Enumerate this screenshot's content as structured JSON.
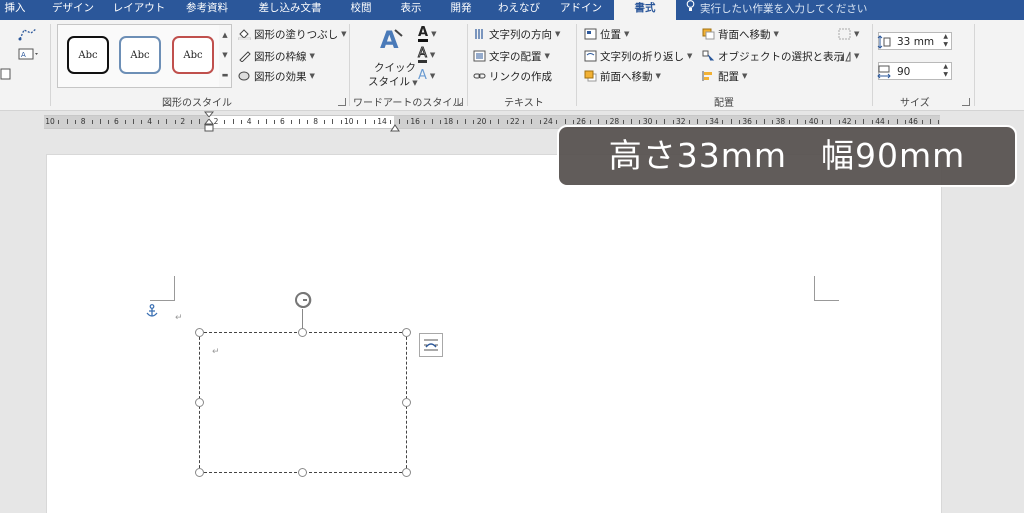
{
  "tabs": [
    {
      "label": "挿入"
    },
    {
      "label": "デザイン"
    },
    {
      "label": "レイアウト"
    },
    {
      "label": "参考資料"
    },
    {
      "label": "差し込み文書"
    },
    {
      "label": "校閲"
    },
    {
      "label": "表示"
    },
    {
      "label": "開発"
    },
    {
      "label": "わえなび"
    },
    {
      "label": "アドイン"
    },
    {
      "label": "書式"
    }
  ],
  "tell_me": "実行したい作業を入力してください",
  "ribbon": {
    "shape_styles": {
      "samples": [
        "Abc",
        "Abc",
        "Abc"
      ],
      "fill": "図形の塗りつぶし",
      "outline": "図形の枠線",
      "effects": "図形の効果",
      "label": "図形のスタイル"
    },
    "wordart": {
      "quick_style_line1": "クイック",
      "quick_style_line2": "スタイル",
      "label": "ワードアートのスタイル"
    },
    "text": {
      "direction": "文字列の方向",
      "align": "文字の配置",
      "link": "リンクの作成",
      "label": "テキスト"
    },
    "arrange": {
      "position": "位置",
      "wrap": "文字列の折り返し",
      "forward": "前面へ移動",
      "backward": "背面へ移動",
      "selection": "オブジェクトの選択と表示",
      "align": "配置",
      "label": "配置"
    },
    "size": {
      "height": "33 mm",
      "width": "90",
      "label": "サイズ"
    }
  },
  "ruler": {
    "numbers": [
      "10",
      "8",
      "6",
      "4",
      "2",
      "2",
      "4",
      "6",
      "8",
      "10",
      "14",
      "16",
      "18",
      "20",
      "22",
      "24",
      "26",
      "28",
      "30",
      "32",
      "34",
      "36",
      "38",
      "40",
      "42",
      "44",
      "46"
    ]
  },
  "caption": "高さ33mm　幅90mm",
  "colors": {
    "tab_bar": "#2b579a",
    "caption_bg": "#55504e"
  }
}
